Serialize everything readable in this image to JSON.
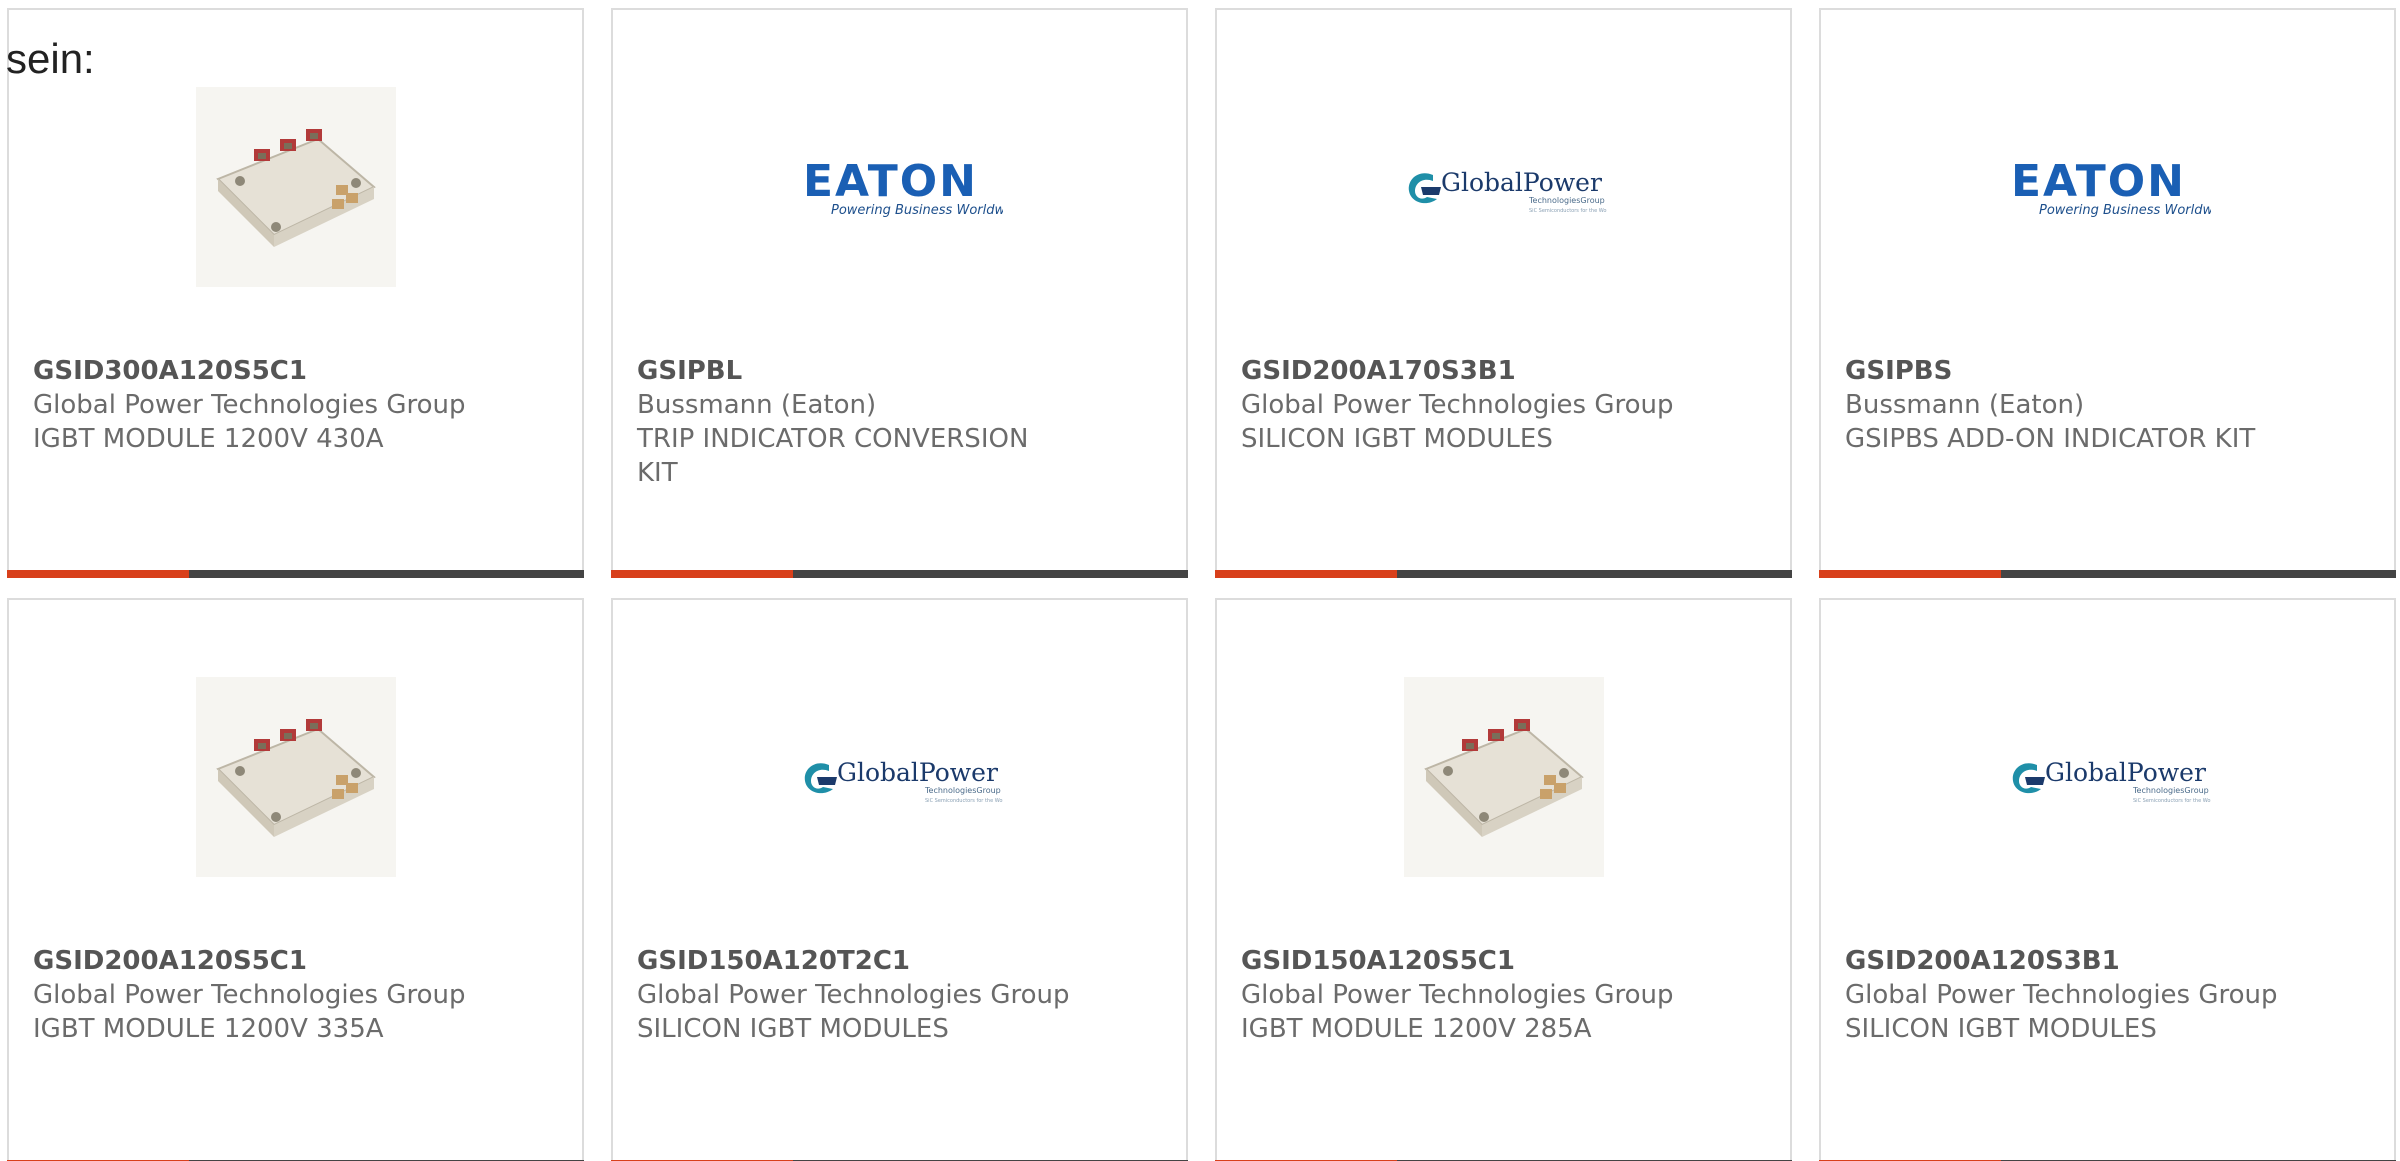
{
  "intro_text": "sein:",
  "colors": {
    "accent": "#d8401b",
    "bar": "#444444",
    "border": "#dcdcdc",
    "eaton_blue": "#1a5fb4",
    "gp_teal": "#1f8fa8"
  },
  "products": [
    {
      "part_number": "GSID300A120S5C1",
      "manufacturer": "Global Power Technologies Group",
      "description": "IGBT MODULE 1200V 430A",
      "image": "igbt-module-image"
    },
    {
      "part_number": "GSIPBL",
      "manufacturer": "Bussmann (Eaton)",
      "description": "TRIP INDICATOR CONVERSION KIT",
      "image": "eaton-logo"
    },
    {
      "part_number": "GSID200A170S3B1",
      "manufacturer": "Global Power Technologies Group",
      "description": "SILICON IGBT MODULES",
      "image": "globalpower-logo"
    },
    {
      "part_number": "GSIPBS",
      "manufacturer": "Bussmann (Eaton)",
      "description": "GSIPBS ADD-ON INDICATOR KIT",
      "image": "eaton-logo"
    },
    {
      "part_number": "GSID200A120S5C1",
      "manufacturer": "Global Power Technologies Group",
      "description": "IGBT MODULE 1200V 335A",
      "image": "igbt-module-image"
    },
    {
      "part_number": "GSID150A120T2C1",
      "manufacturer": "Global Power Technologies Group",
      "description": "SILICON IGBT MODULES",
      "image": "globalpower-logo"
    },
    {
      "part_number": "GSID150A120S5C1",
      "manufacturer": "Global Power Technologies Group",
      "description": "IGBT MODULE 1200V 285A",
      "image": "igbt-module-image"
    },
    {
      "part_number": "GSID200A120S3B1",
      "manufacturer": "Global Power Technologies Group",
      "description": "SILICON IGBT MODULES",
      "image": "globalpower-logo"
    }
  ],
  "logos": {
    "eaton_wordmark": "EATON",
    "eaton_tagline": "Powering Business Worldwide",
    "gp_wordmark": "GlobalPower",
    "gp_sub": "TechnologiesGroup",
    "gp_tiny": "SiC Semiconductors for the World"
  }
}
